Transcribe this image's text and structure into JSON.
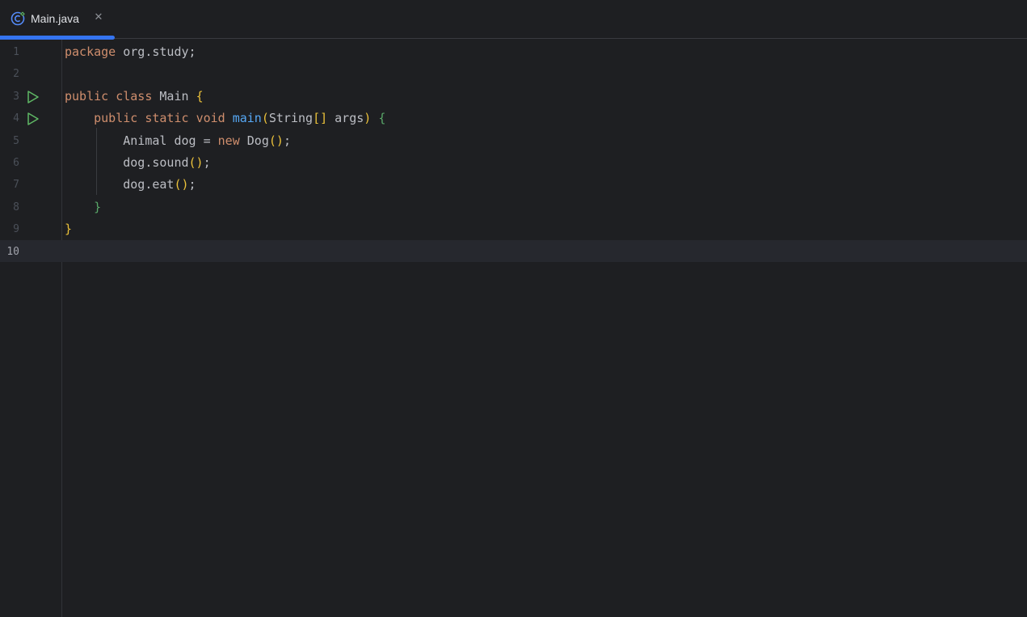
{
  "tab": {
    "label": "Main.java",
    "close_symbol": "✕",
    "icon": "java-class-icon"
  },
  "editor": {
    "lines": [
      {
        "n": "1",
        "tokens": [
          {
            "t": "package",
            "c": "kw"
          },
          {
            "t": " org.study;",
            "c": ""
          }
        ]
      },
      {
        "n": "2",
        "tokens": []
      },
      {
        "n": "3",
        "run": true,
        "tokens": [
          {
            "t": "public",
            "c": "kw"
          },
          {
            "t": " ",
            "c": ""
          },
          {
            "t": "class",
            "c": "kw"
          },
          {
            "t": " Main ",
            "c": ""
          },
          {
            "t": "{",
            "c": "br1"
          }
        ]
      },
      {
        "n": "4",
        "run": true,
        "tokens": [
          {
            "t": "    ",
            "c": ""
          },
          {
            "t": "public",
            "c": "kw"
          },
          {
            "t": " ",
            "c": ""
          },
          {
            "t": "static",
            "c": "kw"
          },
          {
            "t": " ",
            "c": ""
          },
          {
            "t": "void",
            "c": "kw"
          },
          {
            "t": " ",
            "c": ""
          },
          {
            "t": "main",
            "c": "fn"
          },
          {
            "t": "(",
            "c": "br1"
          },
          {
            "t": "String",
            "c": ""
          },
          {
            "t": "[]",
            "c": "br1"
          },
          {
            "t": " args",
            "c": ""
          },
          {
            "t": ")",
            "c": "br1"
          },
          {
            "t": " ",
            "c": ""
          },
          {
            "t": "{",
            "c": "br2"
          }
        ]
      },
      {
        "n": "5",
        "tokens": [
          {
            "t": "        Animal dog = ",
            "c": ""
          },
          {
            "t": "new",
            "c": "kw"
          },
          {
            "t": " Dog",
            "c": ""
          },
          {
            "t": "()",
            "c": "br1"
          },
          {
            "t": ";",
            "c": ""
          }
        ]
      },
      {
        "n": "6",
        "tokens": [
          {
            "t": "        dog.sound",
            "c": ""
          },
          {
            "t": "()",
            "c": "br1"
          },
          {
            "t": ";",
            "c": ""
          }
        ]
      },
      {
        "n": "7",
        "tokens": [
          {
            "t": "        dog.eat",
            "c": ""
          },
          {
            "t": "()",
            "c": "br1"
          },
          {
            "t": ";",
            "c": ""
          }
        ]
      },
      {
        "n": "8",
        "tokens": [
          {
            "t": "    ",
            "c": ""
          },
          {
            "t": "}",
            "c": "br2"
          }
        ]
      },
      {
        "n": "9",
        "tokens": [
          {
            "t": "}",
            "c": "br1"
          }
        ]
      },
      {
        "n": "10",
        "current": true,
        "tokens": []
      }
    ]
  },
  "colors": {
    "accent": "#3574f0",
    "run_icon": "#5fb865",
    "keyword": "#cf8e6d",
    "function": "#56a8f5"
  }
}
